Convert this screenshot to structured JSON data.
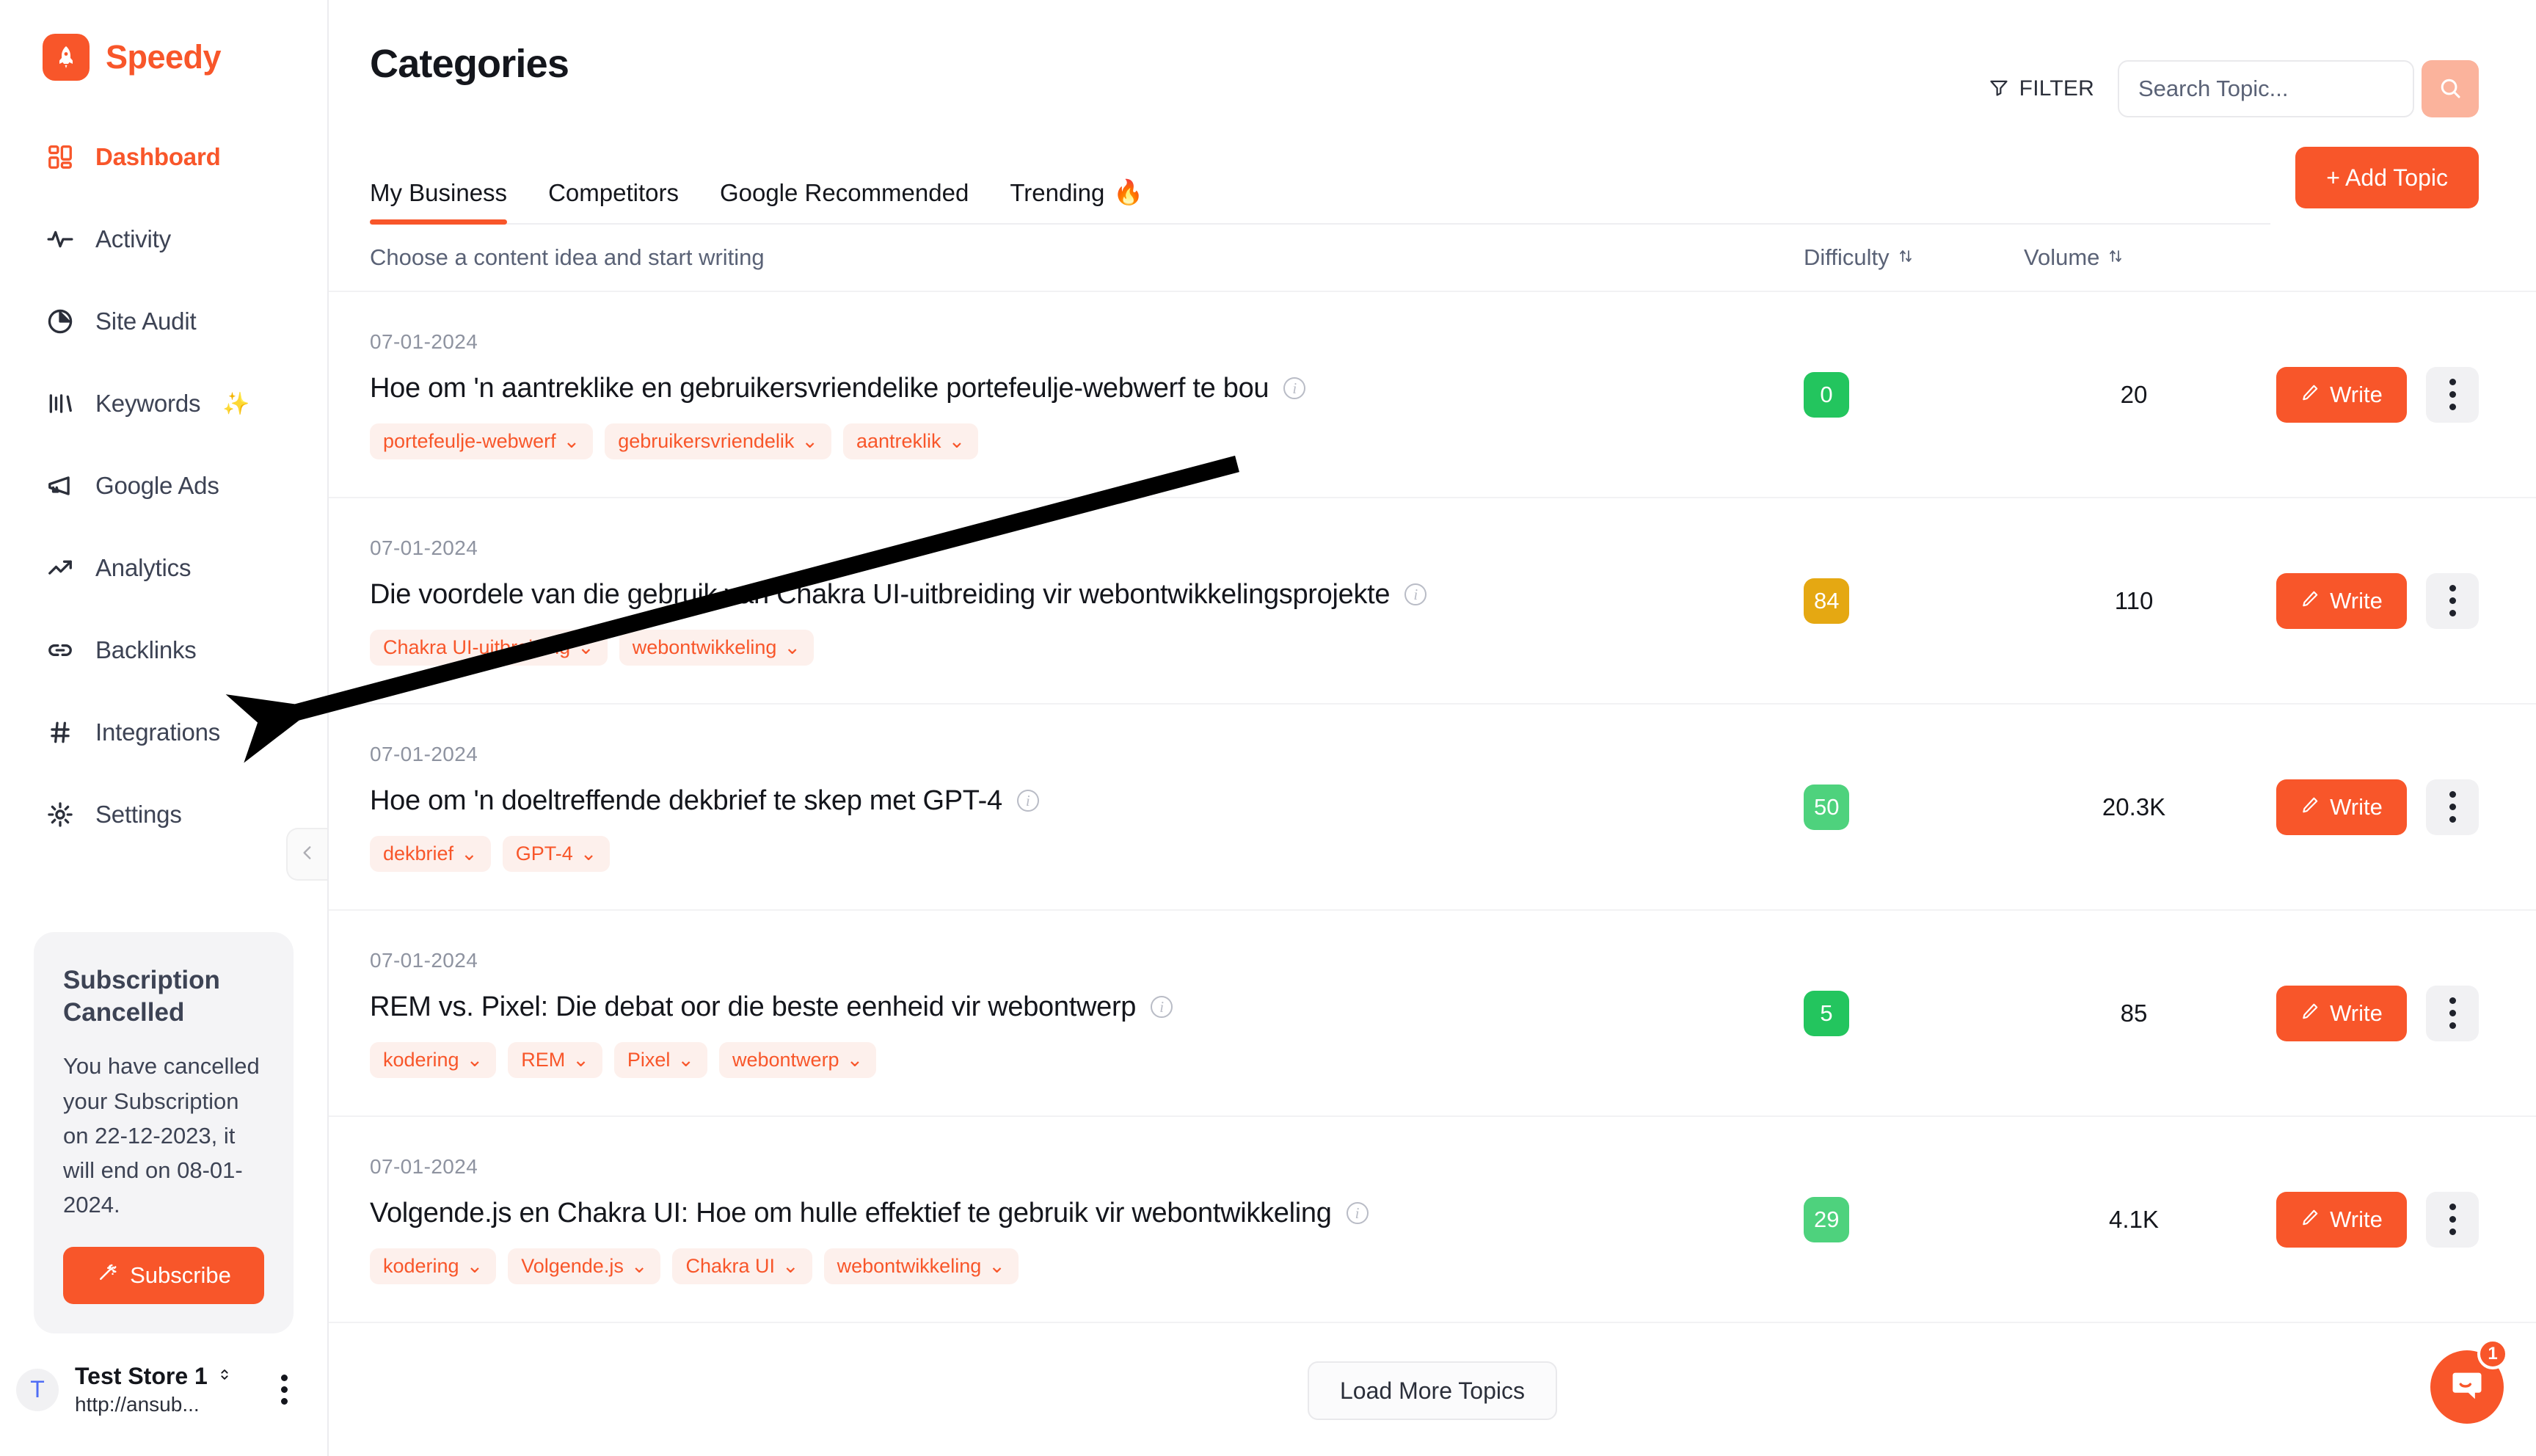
{
  "brand": {
    "name": "Speedy",
    "mark_icon": "rocket-icon",
    "accent": "#F8562A"
  },
  "sidebar": {
    "items": [
      {
        "label": "Dashboard",
        "icon": "grid-icon",
        "active": true
      },
      {
        "label": "Activity",
        "icon": "pulse-icon",
        "active": false
      },
      {
        "label": "Site Audit",
        "icon": "pie-chart-icon",
        "active": false
      },
      {
        "label": "Keywords",
        "icon": "bars-icon",
        "active": false,
        "badge": "✨"
      },
      {
        "label": "Google Ads",
        "icon": "megaphone-icon",
        "active": false
      },
      {
        "label": "Analytics",
        "icon": "trend-up-icon",
        "active": false
      },
      {
        "label": "Backlinks",
        "icon": "link-icon",
        "active": false
      },
      {
        "label": "Integrations",
        "icon": "hash-icon",
        "active": false
      },
      {
        "label": "Settings",
        "icon": "gear-icon",
        "active": false
      }
    ],
    "collapse_icon": "chevron-left-icon",
    "subscription": {
      "title": "Subscription Cancelled",
      "body": "You have cancelled your Subscription on 22-12-2023, it will end on 08-01-2024.",
      "button_label": "Subscribe",
      "button_icon": "magic-wand-icon",
      "button_color": "#F8562A"
    },
    "store": {
      "avatar_letter": "T",
      "name": "Test Store 1",
      "url": "http://ansub...",
      "switch_icon": "chevron-up-down-icon",
      "menu_icon": "kebab-icon"
    }
  },
  "header": {
    "title": "Categories",
    "filter_label": "FILTER",
    "filter_icon": "funnel-icon",
    "search_placeholder": "Search Topic...",
    "search_value": "",
    "search_icon": "search-icon",
    "add_topic_label": "+ Add Topic"
  },
  "tabs": [
    {
      "label": "My Business",
      "active": true,
      "emoji": ""
    },
    {
      "label": "Competitors",
      "active": false,
      "emoji": ""
    },
    {
      "label": "Google Recommended",
      "active": false,
      "emoji": ""
    },
    {
      "label": "Trending",
      "active": false,
      "emoji": "🔥"
    }
  ],
  "table": {
    "hint": "Choose a content idea and start writing",
    "col_difficulty": "Difficulty",
    "col_volume": "Volume",
    "sort_icon": "sort-arrows-icon",
    "info_icon": "info-icon",
    "write_label": "Write",
    "write_icon": "pencil-icon",
    "kebab_icon": "kebab-icon",
    "rows": [
      {
        "date": "07-01-2024",
        "title": "Hoe om 'n aantreklike en gebruikersvriendelike portefeulje-webwerf te bou",
        "tags": [
          "portefeulje-webwerf",
          "gebruikersvriendelik",
          "aantreklik"
        ],
        "difficulty": "0",
        "difficulty_color": "#23C55E",
        "volume": "20"
      },
      {
        "date": "07-01-2024",
        "title": "Die voordele van die gebruik van Chakra UI-uitbreiding vir webontwikkelingsprojekte",
        "tags": [
          "Chakra UI-uitbreiding",
          "webontwikkeling"
        ],
        "difficulty": "84",
        "difficulty_color": "#E5A812",
        "volume": "110"
      },
      {
        "date": "07-01-2024",
        "title": "Hoe om 'n doeltreffende dekbrief te skep met GPT-4",
        "tags": [
          "dekbrief",
          "GPT-4"
        ],
        "difficulty": "50",
        "difficulty_color": "#4ED27D",
        "volume": "20.3K"
      },
      {
        "date": "07-01-2024",
        "title": "REM vs. Pixel: Die debat oor die beste eenheid vir webontwerp",
        "tags": [
          "kodering",
          "REM",
          "Pixel",
          "webontwerp"
        ],
        "difficulty": "5",
        "difficulty_color": "#23C55E",
        "volume": "85"
      },
      {
        "date": "07-01-2024",
        "title": "Volgende.js en Chakra UI: Hoe om hulle effektief te gebruik vir webontwikkeling",
        "tags": [
          "kodering",
          "Volgende.js",
          "Chakra UI",
          "webontwikkeling"
        ],
        "difficulty": "29",
        "difficulty_color": "#4ED27D",
        "volume": "4.1K"
      }
    ],
    "load_more_label": "Load More Topics"
  },
  "chat": {
    "icon": "chat-bubble-icon",
    "unread_count": "1",
    "color": "#F8562A"
  },
  "annotation": {
    "type": "arrow",
    "points_to": "Integrations",
    "color": "#000000"
  }
}
